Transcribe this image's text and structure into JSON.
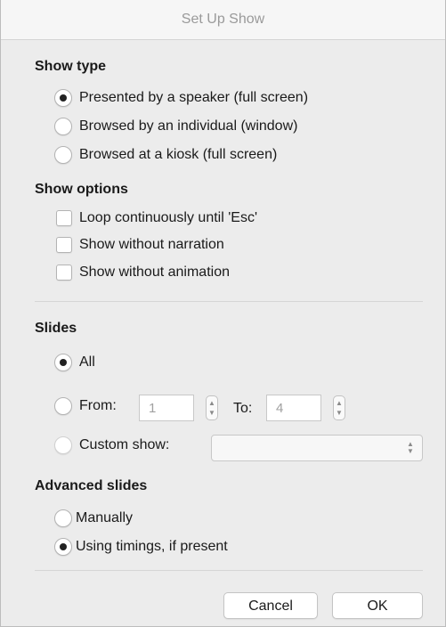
{
  "window": {
    "title": "Set Up Show"
  },
  "show_type": {
    "heading": "Show type",
    "options": [
      {
        "label": "Presented by a speaker (full screen)",
        "checked": true
      },
      {
        "label": "Browsed by an individual (window)",
        "checked": false
      },
      {
        "label": "Browsed at a kiosk (full screen)",
        "checked": false
      }
    ]
  },
  "show_options": {
    "heading": "Show options",
    "options": [
      {
        "label": "Loop continuously until 'Esc'",
        "checked": false
      },
      {
        "label": "Show without narration",
        "checked": false
      },
      {
        "label": "Show without animation",
        "checked": false
      }
    ]
  },
  "slides": {
    "heading": "Slides",
    "all_label": "All",
    "all_checked": true,
    "from_label": "From:",
    "from_value": "1",
    "to_label": "To:",
    "to_value": "4",
    "custom_show_label": "Custom show:",
    "custom_show_value": ""
  },
  "advance_slides": {
    "heading": "Advanced slides",
    "options": [
      {
        "label": "Manually",
        "checked": false
      },
      {
        "label": "Using timings, if present",
        "checked": true
      }
    ]
  },
  "buttons": {
    "cancel": "Cancel",
    "ok": "OK"
  }
}
